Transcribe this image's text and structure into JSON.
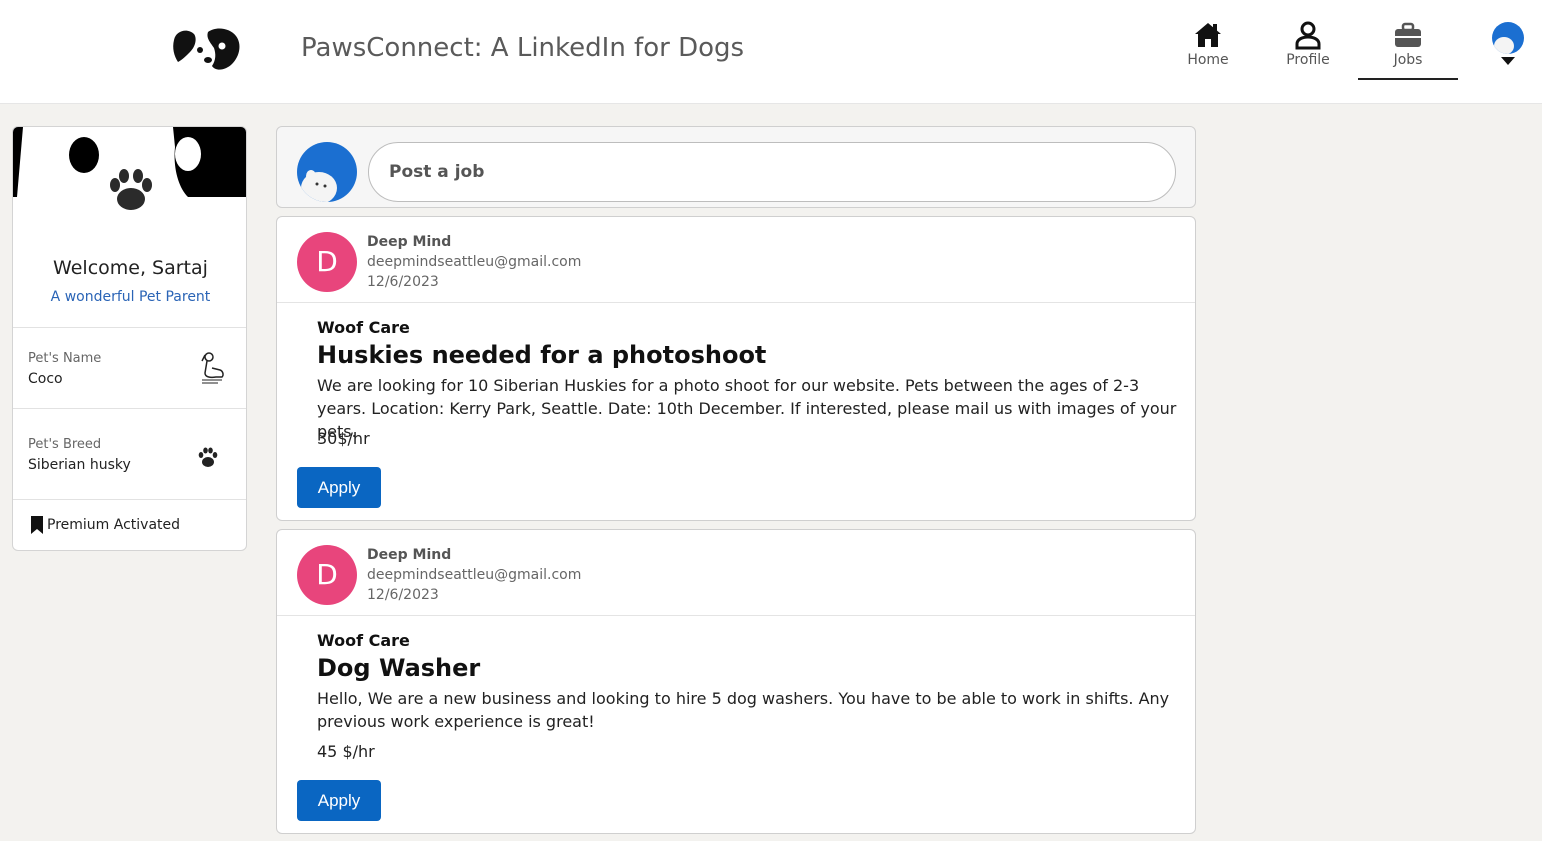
{
  "header": {
    "app_title": "PawsConnect: A LinkedIn for Dogs",
    "nav": [
      {
        "label": "Home",
        "icon": "home-icon"
      },
      {
        "label": "Profile",
        "icon": "person-icon"
      },
      {
        "label": "Jobs",
        "icon": "briefcase-icon",
        "active": true
      }
    ],
    "accent_color": "#0a66c2"
  },
  "profile": {
    "welcome": "Welcome, Sartaj",
    "tagline": "A wonderful Pet Parent",
    "pet_name_label": "Pet's Name",
    "pet_name": "Coco",
    "pet_breed_label": "Pet's Breed",
    "pet_breed": "Siberian husky",
    "premium": "Premium Activated"
  },
  "post": {
    "placeholder": "Post a job"
  },
  "jobs": [
    {
      "avatar_letter": "D",
      "poster": "Deep Mind",
      "email": "deepmindseattleu@gmail.com",
      "date": "12/6/2023",
      "company": "Woof Care",
      "title": "Huskies needed for a photoshoot",
      "description": "We are looking for 10 Siberian Huskies for a photo shoot for our website. Pets between the ages of 2-3 years. Location: Kerry Park, Seattle. Date: 10th December. If interested, please mail us with images of your pets.",
      "pay": "30$/hr",
      "apply_label": "Apply"
    },
    {
      "avatar_letter": "D",
      "poster": "Deep Mind",
      "email": "deepmindseattleu@gmail.com",
      "date": "12/6/2023",
      "company": "Woof Care",
      "title": "Dog Washer",
      "description": "Hello, We are a new business and looking to hire 5 dog washers. You have to be able to work in shifts. Any previous work experience is great!",
      "pay": "45 $/hr",
      "apply_label": "Apply"
    }
  ]
}
